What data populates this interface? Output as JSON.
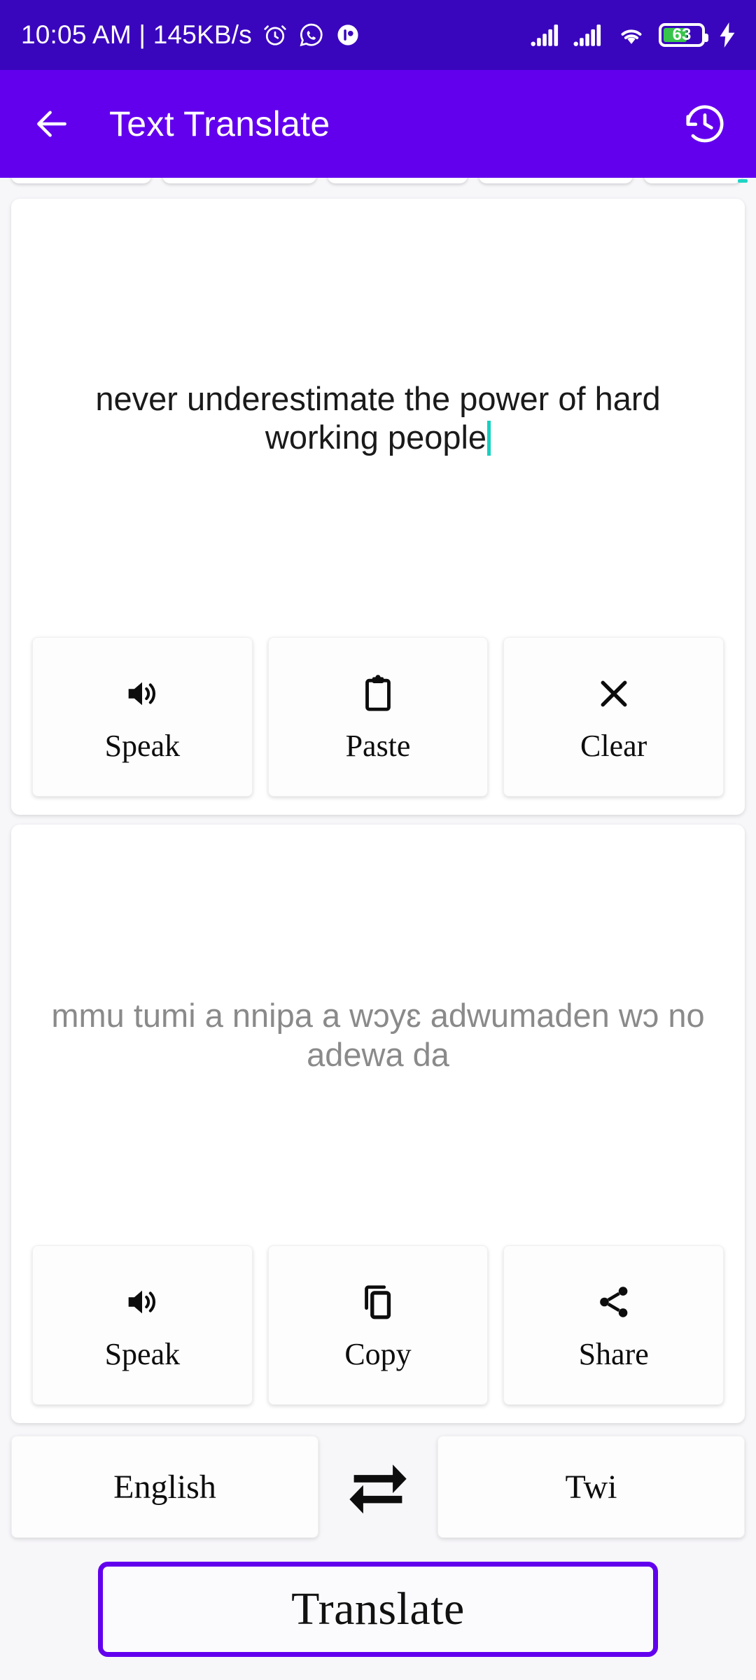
{
  "status_bar": {
    "clock": "10:05 AM | 145KB/s",
    "left_icons": [
      "alarm-clock-icon",
      "whatsapp-icon",
      "app-notification-icon"
    ],
    "right_icons": [
      "signal-sim1-icon",
      "signal-sim2-icon",
      "wifi-icon",
      "battery-icon",
      "charging-bolt-icon"
    ],
    "battery_percent": "63",
    "battery_fill_color": "#37C64B",
    "background_color": "#3A06BD"
  },
  "app_bar": {
    "back_icon": "arrow-left-icon",
    "title": "Text Translate",
    "history_icon": "history-clock-icon",
    "background_color": "#6200EE"
  },
  "source_card": {
    "input_value": "never underestimate the power of hard working people",
    "caret_color": "#18CFC0",
    "actions": [
      {
        "label": "Speak",
        "icon": "speaker-icon"
      },
      {
        "label": "Paste",
        "icon": "clipboard-icon"
      },
      {
        "label": "Clear",
        "icon": "close-x-icon"
      }
    ]
  },
  "target_card": {
    "output_value": "mmu tumi a nnipa a wɔyɛ adwumaden wɔ no adewa da",
    "output_color": "#8a8a8a",
    "actions": [
      {
        "label": "Speak",
        "icon": "speaker-icon"
      },
      {
        "label": "Copy",
        "icon": "copy-icon"
      },
      {
        "label": "Share",
        "icon": "share-icon"
      }
    ]
  },
  "language_row": {
    "source_language": "English",
    "target_language": "Twi",
    "swap_icon": "swap-horizontal-icon"
  },
  "translate_button": {
    "label": "Translate",
    "border_color": "#6200EE"
  }
}
